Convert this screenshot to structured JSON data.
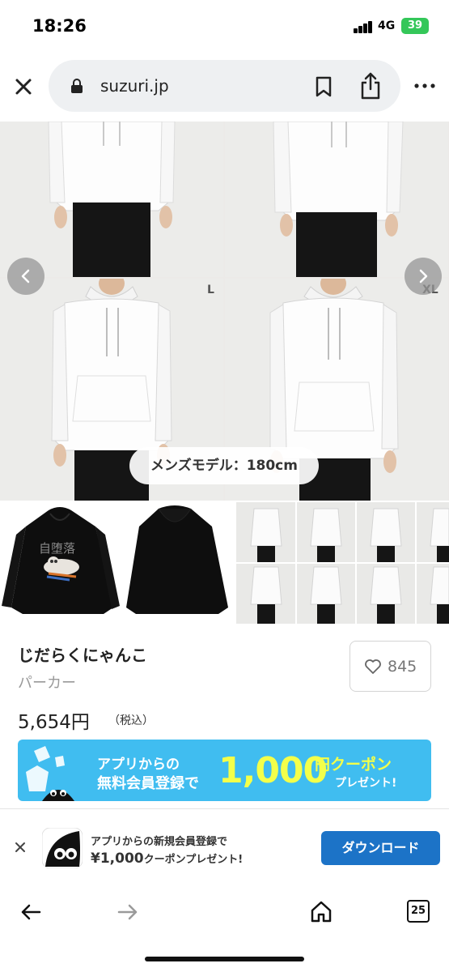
{
  "status_bar": {
    "time": "18:26",
    "network": "4G",
    "battery": "39"
  },
  "browser": {
    "url": "suzuri.jp",
    "icons": [
      "close-icon",
      "lock-icon",
      "bookmark-icon",
      "share-icon",
      "more-icon"
    ]
  },
  "gallery": {
    "size_labels": [
      "L",
      "XL"
    ],
    "model_caption": "メンズモデル：180cm",
    "print_text": "自堕落"
  },
  "product": {
    "title": "じだらくにゃんこ",
    "category": "パーカー",
    "price": "5,654円",
    "tax_note": "（税込）",
    "like_count": "845"
  },
  "promo_banner": {
    "line1": "アプリからの",
    "line2": "無料会員登録で",
    "amount": "1,000",
    "unit": "円クーポン",
    "present": "プレゼント!"
  },
  "download_bar": {
    "line1": "アプリからの新規会員登録で",
    "amount": "¥1,000",
    "line2_suffix": "クーポンプレゼント!",
    "button": "ダウンロード"
  },
  "toolbar": {
    "tab_count": "25",
    "icons": [
      "back-arrow-icon",
      "forward-arrow-icon",
      "home-icon",
      "tabs-icon"
    ]
  },
  "colors": {
    "accent_blue": "#1c73c7",
    "promo_blue": "#40bdf0",
    "promo_yellow": "#f3ff4a",
    "battery_green": "#34c759"
  }
}
